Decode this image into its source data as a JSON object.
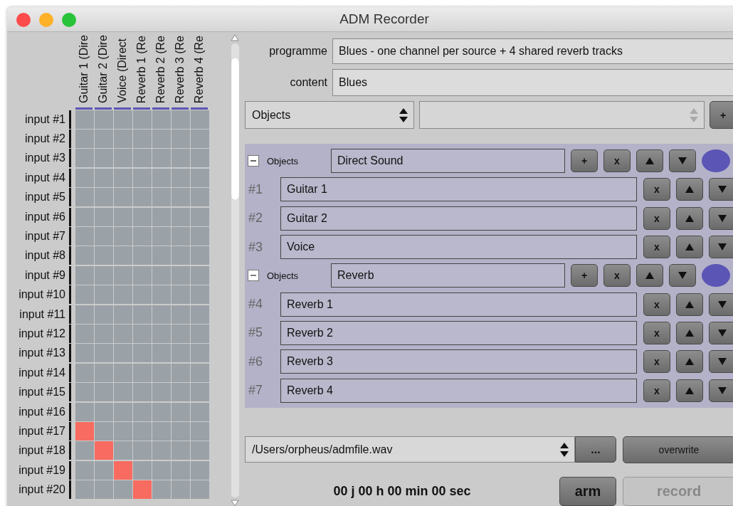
{
  "window": {
    "title": "ADM Recorder"
  },
  "matrix": {
    "columns": [
      "Guitar 1 (Dire",
      "Guitar 2 (Dire",
      "Voice (Direct",
      "Reverb 1 (Re",
      "Reverb 2 (Re",
      "Reverb 3 (Re",
      "Reverb 4 (Re"
    ],
    "rows": [
      {
        "label": "input #1",
        "cells": [
          false,
          false,
          false,
          false,
          false,
          false,
          false
        ]
      },
      {
        "label": "input #2",
        "cells": [
          false,
          false,
          false,
          false,
          false,
          false,
          false
        ]
      },
      {
        "label": "input #3",
        "cells": [
          false,
          false,
          false,
          false,
          false,
          false,
          false
        ]
      },
      {
        "label": "input #4",
        "cells": [
          false,
          false,
          false,
          false,
          false,
          false,
          false
        ]
      },
      {
        "label": "input #5",
        "cells": [
          false,
          false,
          false,
          false,
          false,
          false,
          false
        ]
      },
      {
        "label": "input #6",
        "cells": [
          false,
          false,
          false,
          false,
          false,
          false,
          false
        ]
      },
      {
        "label": "input #7",
        "cells": [
          false,
          false,
          false,
          false,
          false,
          false,
          false
        ]
      },
      {
        "label": "input #8",
        "cells": [
          false,
          false,
          false,
          false,
          false,
          false,
          false
        ]
      },
      {
        "label": "input #9",
        "cells": [
          false,
          false,
          false,
          false,
          false,
          false,
          false
        ]
      },
      {
        "label": "input #10",
        "cells": [
          false,
          false,
          false,
          false,
          false,
          false,
          false
        ]
      },
      {
        "label": "input #11",
        "cells": [
          false,
          false,
          false,
          false,
          false,
          false,
          false
        ]
      },
      {
        "label": "input #12",
        "cells": [
          false,
          false,
          false,
          false,
          false,
          false,
          false
        ]
      },
      {
        "label": "input #13",
        "cells": [
          false,
          false,
          false,
          false,
          false,
          false,
          false
        ]
      },
      {
        "label": "input #14",
        "cells": [
          false,
          false,
          false,
          false,
          false,
          false,
          false
        ]
      },
      {
        "label": "input #15",
        "cells": [
          false,
          false,
          false,
          false,
          false,
          false,
          false
        ]
      },
      {
        "label": "input #16",
        "cells": [
          false,
          false,
          false,
          false,
          false,
          false,
          false
        ]
      },
      {
        "label": "input #17",
        "cells": [
          true,
          false,
          false,
          false,
          false,
          false,
          false
        ]
      },
      {
        "label": "input #18",
        "cells": [
          false,
          true,
          false,
          false,
          false,
          false,
          false
        ]
      },
      {
        "label": "input #19",
        "cells": [
          false,
          false,
          true,
          false,
          false,
          false,
          false
        ]
      },
      {
        "label": "input #20",
        "cells": [
          false,
          false,
          false,
          true,
          false,
          false,
          false
        ]
      }
    ]
  },
  "programme": {
    "label": "programme",
    "value": "Blues - one channel per source + 4 shared reverb tracks"
  },
  "content": {
    "label": "content",
    "value": "Blues"
  },
  "type_select": {
    "value": "Objects"
  },
  "add_button": "+",
  "groups": [
    {
      "label": "Objects",
      "name": "Direct Sound",
      "expanded": true,
      "add": "+",
      "remove": "x",
      "color": "#5b55b5",
      "items": [
        {
          "index": "#1",
          "name": "Guitar 1",
          "remove": "x"
        },
        {
          "index": "#2",
          "name": "Guitar 2",
          "remove": "x"
        },
        {
          "index": "#3",
          "name": "Voice",
          "remove": "x"
        }
      ]
    },
    {
      "label": "Objects",
      "name": "Reverb",
      "expanded": true,
      "add": "+",
      "remove": "x",
      "color": "#5b55b5",
      "items": [
        {
          "index": "#4",
          "name": "Reverb 1",
          "remove": "x"
        },
        {
          "index": "#5",
          "name": "Reverb 2",
          "remove": "x"
        },
        {
          "index": "#6",
          "name": "Reverb 3",
          "remove": "x"
        },
        {
          "index": "#7",
          "name": "Reverb 4",
          "remove": "x"
        }
      ]
    }
  ],
  "file": {
    "path": "/Users/orpheus/admfile.wav",
    "browse": "...",
    "overwrite": "overwrite"
  },
  "timer": "00 j 00 h 00 min 00 sec",
  "arm": {
    "label": "arm"
  },
  "record": {
    "label": "record",
    "disabled": true
  }
}
